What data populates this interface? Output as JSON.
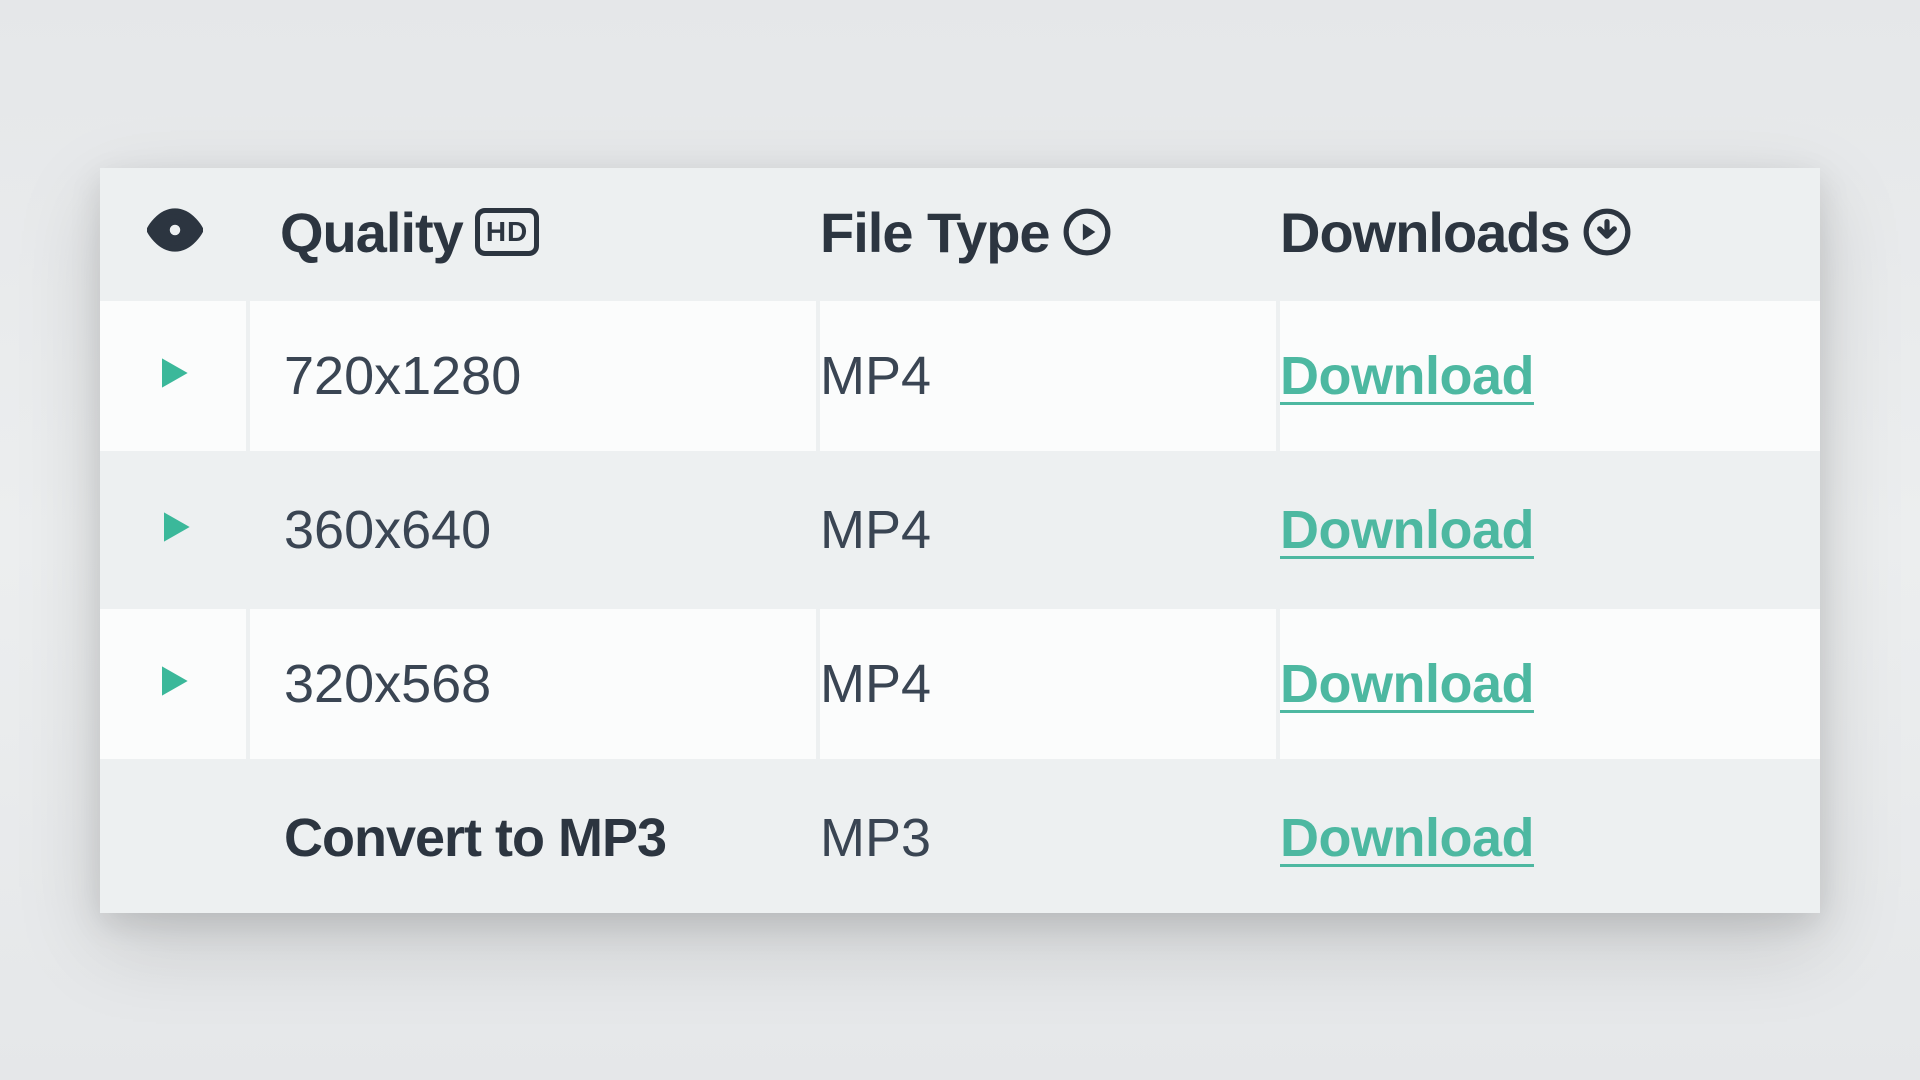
{
  "headers": {
    "quality": "Quality",
    "hd_badge": "HD",
    "file_type": "File Type",
    "downloads": "Downloads"
  },
  "rows": [
    {
      "quality": "720x1280",
      "file_type": "MP4",
      "download_label": "Download",
      "has_play": true,
      "bold": false,
      "alt": false
    },
    {
      "quality": "360x640",
      "file_type": "MP4",
      "download_label": "Download",
      "has_play": true,
      "bold": false,
      "alt": true
    },
    {
      "quality": "320x568",
      "file_type": "MP4",
      "download_label": "Download",
      "has_play": true,
      "bold": false,
      "alt": false
    },
    {
      "quality": "Convert to MP3",
      "file_type": "MP3",
      "download_label": "Download",
      "has_play": false,
      "bold": true,
      "alt": true
    }
  ]
}
